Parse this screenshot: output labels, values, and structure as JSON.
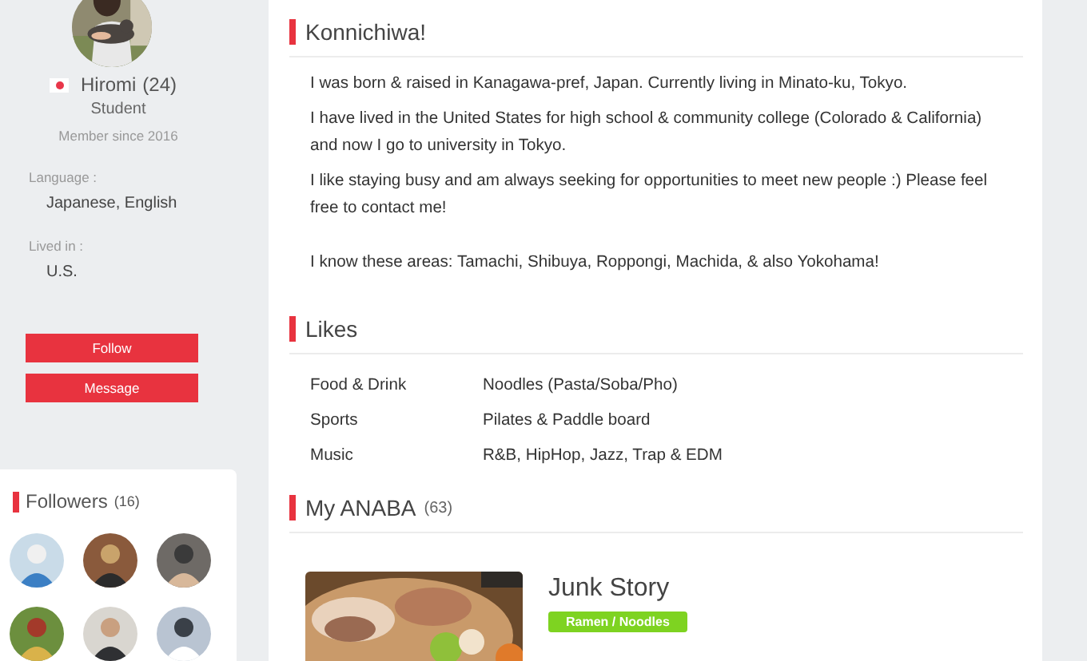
{
  "profile": {
    "name": "Hiromi",
    "age": "(24)",
    "occupation": "Student",
    "member_since": "Member since 2016",
    "language_label": "Language :",
    "language": "Japanese, English",
    "lived_label": "Lived in :",
    "lived": "U.S.",
    "buttons": [
      "Follow",
      "Message"
    ]
  },
  "followers": {
    "title": "Followers",
    "count": "(16)"
  },
  "intro": {
    "title": "Konnichiwa!",
    "paragraphs": [
      "I was born & raised in Kanagawa-pref, Japan. Currently living in Minato-ku, Tokyo.",
      "I have lived in the United States for high school & community college (Colorado & California) and now I go to university in Tokyo.",
      "I like staying busy and am always seeking for opportunities to meet new people :) Please feel free to contact me!",
      "I know these areas: Tamachi, Shibuya, Roppongi, Machida, & also Yokohama!"
    ]
  },
  "likes": {
    "title": "Likes",
    "rows": [
      {
        "label": "Food & Drink",
        "value": "Noodles (Pasta/Soba/Pho)"
      },
      {
        "label": "Sports",
        "value": "Pilates & Paddle board"
      },
      {
        "label": "Music",
        "value": "R&B, HipHop, Jazz, Trap & EDM"
      }
    ]
  },
  "anaba": {
    "title": "My ANABA",
    "count": "(63)",
    "items": [
      {
        "title": "Junk Story",
        "tag": "Ramen / Noodles"
      }
    ]
  }
}
